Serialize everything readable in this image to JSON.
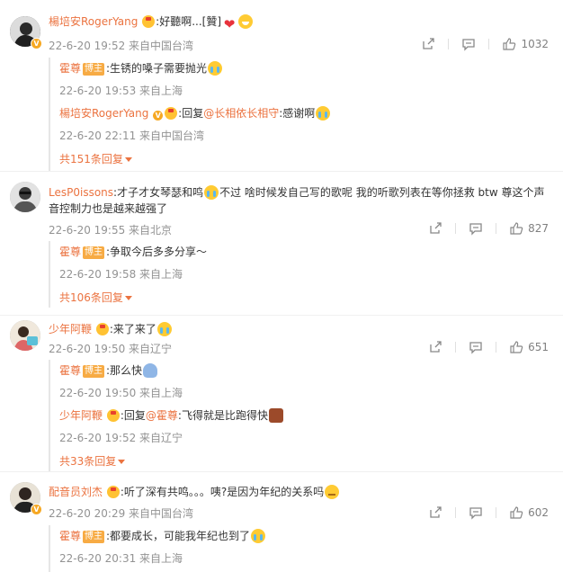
{
  "comments": [
    {
      "user": "楊培安RogerYang",
      "text": ":好聽啊...[贊]",
      "time": "22-6-20 19:52 来自中国台湾",
      "likes": "1032",
      "replies": [
        {
          "user": "霍尊",
          "tag": "博主",
          "text": ":生锈的嗓子需要抛光",
          "time": "22-6-20 19:53 来自上海"
        },
        {
          "user": "楊培安RogerYang",
          "text_prefix": ":回复",
          "mention": "@长相依长相守",
          "text": ":感谢啊",
          "time": "22-6-20 22:11 来自中国台湾"
        }
      ],
      "more": "共151条回复"
    },
    {
      "user": "LesP0issons",
      "text": ":才子才女琴瑟和鸣",
      "text_line1_b": "不过 啥时候发自己写的歌呢 我的听歌列表在等你拯救 btw 尊这个声",
      "text_line2": "音控制力也是越来越强了",
      "time": "22-6-20 19:55 来自北京",
      "likes": "827",
      "replies": [
        {
          "user": "霍尊",
          "tag": "博主",
          "text": ":争取今后多多分享～",
          "time": "22-6-20 19:58 来自上海"
        }
      ],
      "more": "共106条回复"
    },
    {
      "user": "少年阿鞭",
      "text": ":来了来了",
      "time": "22-6-20 19:50 来自辽宁",
      "likes": "651",
      "replies": [
        {
          "user": "霍尊",
          "tag": "博主",
          "text": ":那么快",
          "time": "22-6-20 19:50 来自上海"
        },
        {
          "user": "少年阿鞭",
          "text_prefix": ":回复",
          "mention": "@霍尊",
          "text": ":飞得就是比跑得快",
          "time": "22-6-20 19:52 来自辽宁"
        }
      ],
      "more": "共33条回复"
    },
    {
      "user": "配音员刘杰",
      "text": ":听了深有共鸣。。。咦?是因为年纪的关系吗",
      "time": "22-6-20 20:29 来自中国台湾",
      "likes": "602",
      "replies": [
        {
          "user": "霍尊",
          "tag": "博主",
          "text": ":都要成长，可能我年纪也到了",
          "time": "22-6-20 20:31 来自上海"
        }
      ]
    }
  ],
  "icons": {
    "share": "share-icon",
    "comment": "comment-icon",
    "like": "like-thumb-icon"
  },
  "colors": {
    "username": "#eb7340",
    "meta": "#939393",
    "tag": "#f7ab44"
  }
}
